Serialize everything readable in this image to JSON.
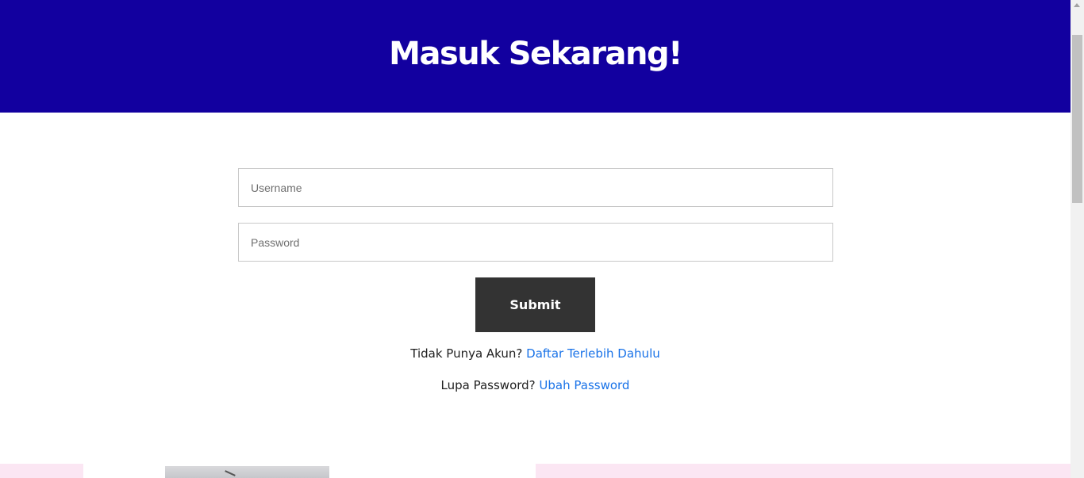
{
  "header": {
    "title": "Masuk Sekarang!"
  },
  "form": {
    "username": {
      "placeholder": "Username",
      "value": ""
    },
    "password": {
      "placeholder": "Password",
      "value": ""
    },
    "submit_label": "Submit"
  },
  "links": {
    "register_prompt": "Tidak Punya Akun?",
    "register_link": "Daftar Terlebih Dahulu",
    "forgot_prompt": "Lupa Password?",
    "forgot_link": "Ubah Password"
  },
  "colors": {
    "header_bg": "#12009f",
    "button_bg": "#333333",
    "link": "#1a73e8",
    "footer_band": "#fbe6f3"
  }
}
